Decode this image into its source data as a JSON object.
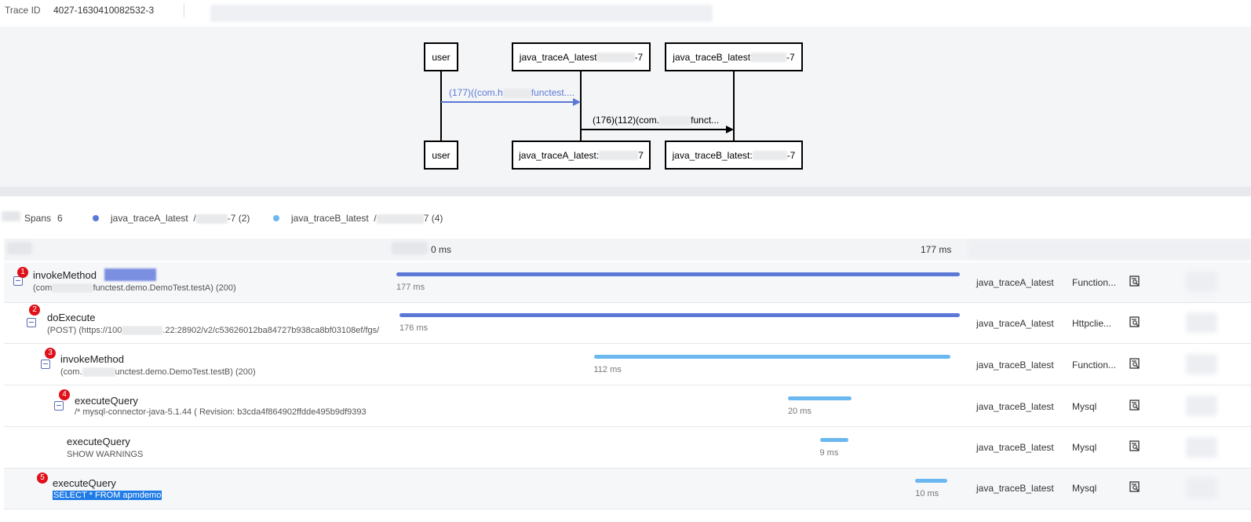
{
  "header": {
    "trace_id_label": "Trace ID",
    "trace_id_value": "4027-1630410082532-3"
  },
  "diagram": {
    "nodes": {
      "user_top": "user",
      "a_top_prefix": "java_traceA_latest",
      "a_top_suffix": "-7",
      "b_top_prefix": "java_traceB_latest",
      "b_top_suffix": "-7",
      "user_bottom": "user",
      "a_bottom_prefix": "java_traceA_latest:",
      "a_bottom_suffix": "7",
      "b_bottom_prefix": "java_traceB_latest:",
      "b_bottom_suffix": "-7"
    },
    "messages": {
      "m1_prefix": "(177)((com.h",
      "m1_suffix": "functest....",
      "m2_prefix": "(176)(112)(com.",
      "m2_suffix": "funct..."
    },
    "colors": {
      "m1": "#5b78d6",
      "m2": "#000000"
    }
  },
  "legend": {
    "spans_label": "Spans",
    "spans_count": "6",
    "series": [
      {
        "label_prefix": "java_traceA_latest",
        "label_suffix": "-7 (2)",
        "color": "#5b78d6"
      },
      {
        "label_prefix": "java_traceB_latest",
        "label_suffix": "7 (4)",
        "color": "#6bb7f0"
      }
    ]
  },
  "table": {
    "header": {
      "start": "0 ms",
      "end": "177 ms"
    },
    "rows": [
      {
        "index": "1",
        "op": "invokeMethod",
        "detail_prefix": "(com",
        "detail_suffix": "functest.demo.DemoTest.testA) (200)",
        "start": 0,
        "duration_ms": 177,
        "duration": "177 ms",
        "service": "java_traceA_latest",
        "type": "Function...",
        "color": "#5b78d6"
      },
      {
        "index": "2",
        "op": "doExecute",
        "detail_prefix": "(POST) (https://100",
        "detail_suffix": ".22:28902/v2/c53626012ba84727b938ca8bf03108ef/fgs/",
        "start": 1,
        "duration_ms": 176,
        "duration": "176 ms",
        "service": "java_traceA_latest",
        "type": "Httpclie...",
        "color": "#5b78d6"
      },
      {
        "index": "3",
        "op": "invokeMethod",
        "detail_prefix": "(com.",
        "detail_suffix": "unctest.demo.DemoTest.testB) (200)",
        "start": 62,
        "duration_ms": 112,
        "duration": "112 ms",
        "service": "java_traceB_latest",
        "type": "Function...",
        "color": "#6bb7f0"
      },
      {
        "index": "4",
        "op": "executeQuery",
        "detail_prefix": "/* mysql-connector-java-5.1.44 ( Revision: b3cda4f864902ffdde495b9df9393",
        "detail_suffix": "",
        "start": 123,
        "duration_ms": 20,
        "duration": "20 ms",
        "service": "java_traceB_latest",
        "type": "Mysql",
        "color": "#6bb7f0"
      },
      {
        "index": "",
        "op": "executeQuery",
        "detail_prefix": "SHOW WARNINGS",
        "detail_suffix": "",
        "start": 133,
        "duration_ms": 9,
        "duration": "9 ms",
        "service": "java_traceB_latest",
        "type": "Mysql",
        "color": "#6bb7f0"
      },
      {
        "index": "5",
        "op": "executeQuery",
        "detail_prefix": "SELECT * FROM apmdemo",
        "detail_suffix": "",
        "start": 163,
        "duration_ms": 10,
        "duration": "10 ms",
        "service": "java_traceB_latest",
        "type": "Mysql",
        "color": "#6bb7f0"
      }
    ]
  }
}
